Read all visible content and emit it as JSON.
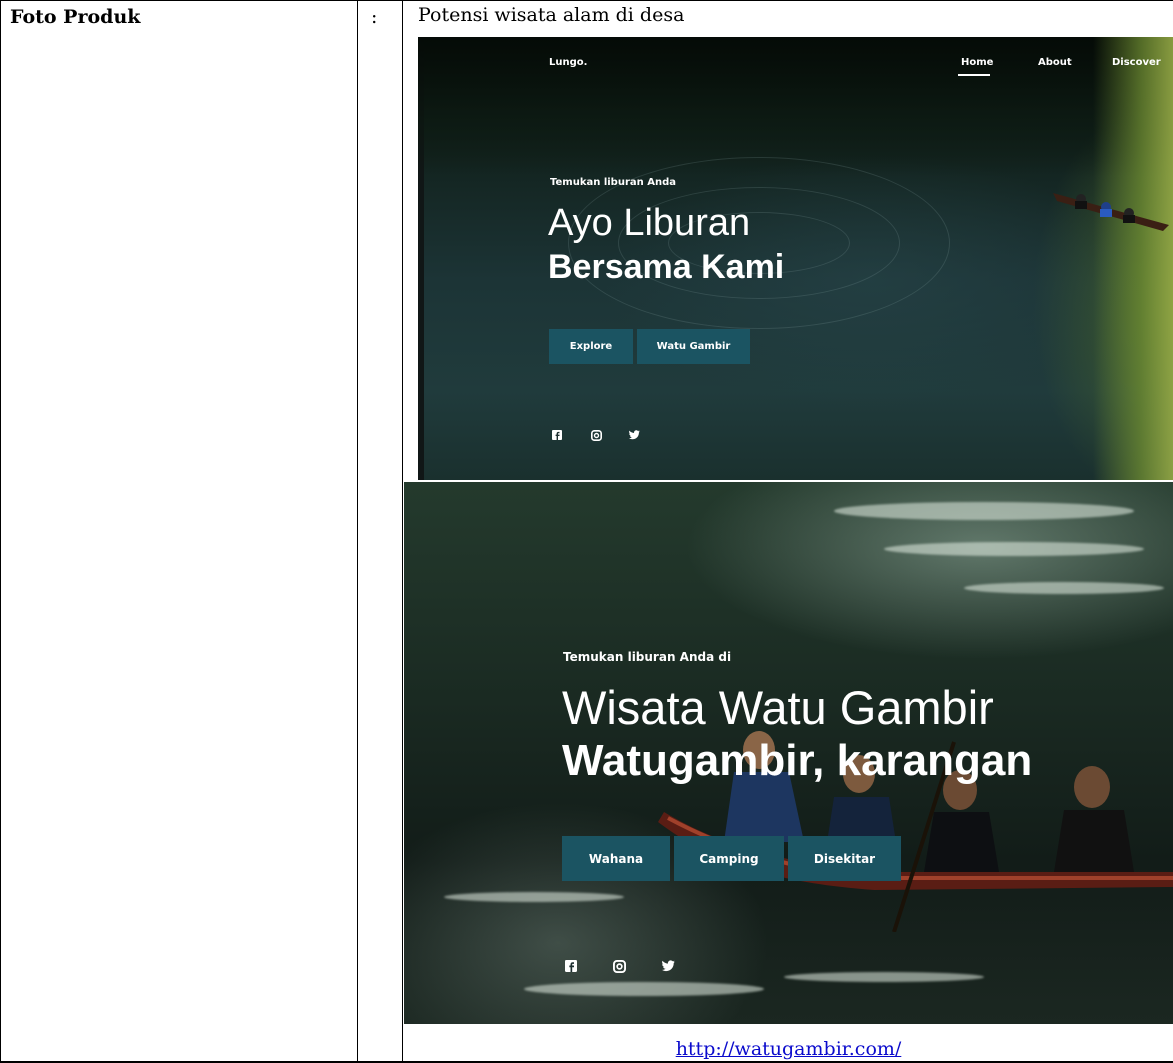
{
  "table": {
    "label": "Foto Produk",
    "colon": ":",
    "caption": "Potensi wisata alam di desa",
    "url": "http://watugambir.com/"
  },
  "screenshot_1": {
    "logo": "Lungo.",
    "nav": [
      "Home",
      "About",
      "Discover"
    ],
    "active_nav": "Home",
    "kicker": "Temukan liburan Anda",
    "headline_1": "Ayo Liburan",
    "headline_2": "Bersama Kami",
    "buttons": [
      "Explore",
      "Watu Gambir"
    ],
    "social_icons": [
      "facebook-icon",
      "instagram-icon",
      "twitter-icon"
    ],
    "button_color": "#1b5462"
  },
  "screenshot_2": {
    "kicker": "Temukan liburan Anda di",
    "headline_1": "Wisata Watu Gambir",
    "headline_2": "Watugambir, karangan",
    "buttons": [
      "Wahana",
      "Camping",
      "Disekitar"
    ],
    "social_icons": [
      "facebook-icon",
      "instagram-icon",
      "twitter-icon"
    ],
    "button_color": "#1b5462"
  }
}
